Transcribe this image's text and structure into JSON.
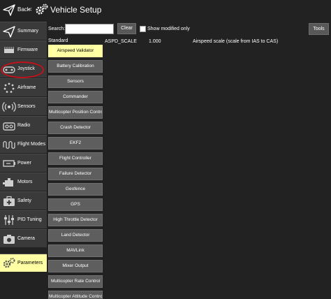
{
  "header": {
    "back_label": "Back",
    "separator": "<",
    "title": "Vehicle Setup"
  },
  "sidebar": {
    "items": [
      {
        "label": "Summary",
        "icon": "plane-icon",
        "active": false
      },
      {
        "label": "Firmware",
        "icon": "firmware-chip-icon",
        "active": false
      },
      {
        "label": "Joystick",
        "icon": "joystick-icon",
        "active": false
      },
      {
        "label": "Airframe",
        "icon": "airframe-dots-icon",
        "active": false
      },
      {
        "label": "Sensors",
        "icon": "radar-icon",
        "active": false
      },
      {
        "label": "Radio",
        "icon": "radio-icon",
        "active": false
      },
      {
        "label": "Flight Modes",
        "icon": "wave-icon",
        "active": false
      },
      {
        "label": "Power",
        "icon": "battery-icon",
        "active": false
      },
      {
        "label": "Motors",
        "icon": "motor-icon",
        "active": false
      },
      {
        "label": "Safety",
        "icon": "first-aid-icon",
        "active": false
      },
      {
        "label": "PID Tuning",
        "icon": "sliders-icon",
        "active": false
      },
      {
        "label": "Camera",
        "icon": "camera-icon",
        "active": false
      },
      {
        "label": "Parameters",
        "icon": "gears-icon",
        "active": true
      }
    ],
    "highlight_color": "#c1121b",
    "active_color": "#ffffa4"
  },
  "search": {
    "label": "Search:",
    "value": "",
    "clear_label": "Clear",
    "show_modified_label": "Show modified only",
    "show_modified_checked": false,
    "tools_label": "Tools"
  },
  "groups": {
    "header": "Standard",
    "items": [
      {
        "label": "Airspeed Validator",
        "active": true
      },
      {
        "label": "Battery Calibration",
        "active": false
      },
      {
        "label": "Sensors",
        "active": false
      },
      {
        "label": "Commander",
        "active": false
      },
      {
        "label": "Multicopter Position Control",
        "active": false
      },
      {
        "label": "Crash Detector",
        "active": false
      },
      {
        "label": "EKF2",
        "active": false
      },
      {
        "label": "Flight Controller",
        "active": false
      },
      {
        "label": "Failure Detector",
        "active": false
      },
      {
        "label": "Geofence",
        "active": false
      },
      {
        "label": "GPS",
        "active": false
      },
      {
        "label": "High Throttle Detector",
        "active": false
      },
      {
        "label": "Land Detector",
        "active": false
      },
      {
        "label": "MAVLink",
        "active": false
      },
      {
        "label": "Mixer Output",
        "active": false
      },
      {
        "label": "Multicopter Rate Control",
        "active": false
      },
      {
        "label": "Multicopter Attitude Control",
        "active": false
      }
    ]
  },
  "parameters": [
    {
      "name": "ASPD_SCALE",
      "value": "1.000",
      "description": "Airspeed scale (scale from IAS to CAS)"
    }
  ]
}
